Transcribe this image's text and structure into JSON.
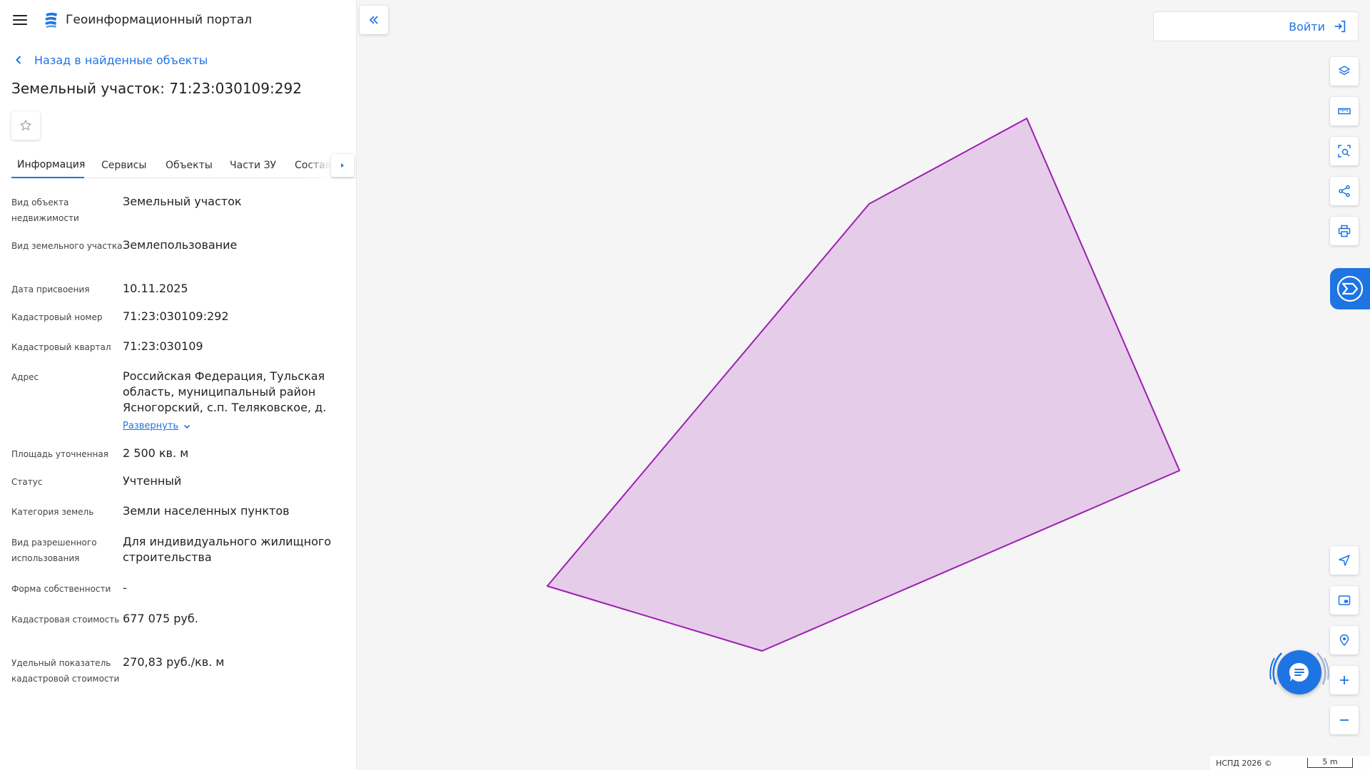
{
  "header": {
    "app_title": "Геоинформационный портал",
    "menu_icon": "hamburger-menu-icon",
    "logo_icon": "portal-logo-icon"
  },
  "back_link": {
    "label": "Назад в найденные объекты"
  },
  "object": {
    "title": "Земельный участок: 71:23:030109:292"
  },
  "tabs": [
    {
      "label": "Информация",
      "active": true
    },
    {
      "label": "Сервисы"
    },
    {
      "label": "Объекты"
    },
    {
      "label": "Части ЗУ"
    },
    {
      "label": "Состав"
    }
  ],
  "info": [
    {
      "label": "Вид объекта недвижимости",
      "value": "Земельный участок"
    },
    {
      "label": "Вид земельного участка",
      "value": "Землепользование"
    },
    {
      "label": "Дата присвоения",
      "value": "10.11.2025"
    },
    {
      "label": "Кадастровый номер",
      "value": "71:23:030109:292"
    },
    {
      "label": "Кадастровый квартал",
      "value": "71:23:030109"
    },
    {
      "label": "Адрес",
      "value": "Российская Федерация, Тульская область, муниципальный район Ясногорский, с.п. Теляковское, д.",
      "expand_label": "Развернуть"
    },
    {
      "label": "Площадь уточненная",
      "value": "2 500 кв. м"
    },
    {
      "label": "Статус",
      "value": "Учтенный"
    },
    {
      "label": "Категория земель",
      "value": "Земли населенных пунктов"
    },
    {
      "label": "Вид разрешенного использования",
      "value": "Для индивидуального жилищного строительства"
    },
    {
      "label": "Форма собственности",
      "value": "-"
    },
    {
      "label": "Кадастровая стоимость",
      "value": "677 075 руб."
    },
    {
      "label": "Удельный показатель кадастровой стоимости",
      "value": "270,83 руб./кв. м"
    }
  ],
  "map": {
    "login_label": "Войти",
    "attribution": "НСПД 2026 ©",
    "scale_label": "5 m",
    "parcel_fill": "#e5cce9",
    "parcel_stroke": "#9b1fb0",
    "accent": "#1f74e4",
    "tools_top": [
      "layers-icon",
      "ruler-icon",
      "area-search-icon",
      "share-icon",
      "print-icon"
    ],
    "tools_bottom": [
      "navigate-icon",
      "minimap-icon",
      "geolocate-icon",
      "zoom-in-icon",
      "zoom-out-icon"
    ]
  }
}
